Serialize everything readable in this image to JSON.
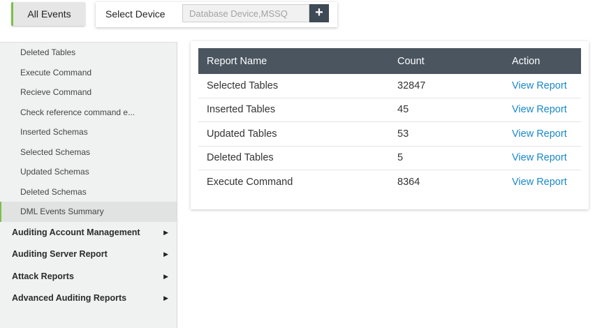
{
  "top_bar": {
    "all_events_label": "All Events",
    "select_device_label": "Select Device",
    "device_input_placeholder": "Database Device,MSSQ",
    "add_button_label": "+"
  },
  "sidebar": {
    "sub_items": [
      {
        "label": "Deleted Tables"
      },
      {
        "label": "Execute Command"
      },
      {
        "label": "Recieve Command"
      },
      {
        "label": "Check reference command e..."
      },
      {
        "label": "Inserted Schemas"
      },
      {
        "label": "Selected Schemas"
      },
      {
        "label": "Updated Schemas"
      },
      {
        "label": "Deleted Schemas"
      },
      {
        "label": "DML Events Summary",
        "active": true
      }
    ],
    "groups": [
      {
        "label": "Auditing Account Management",
        "icon": "caret-right-icon"
      },
      {
        "label": "Auditing Server Report",
        "icon": "caret-right-icon"
      },
      {
        "label": "Attack Reports",
        "icon": "caret-right-icon"
      },
      {
        "label": "Advanced Auditing Reports",
        "icon": "caret-right-icon"
      }
    ]
  },
  "report_table": {
    "headers": {
      "name": "Report Name",
      "count": "Count",
      "action": "Action"
    },
    "rows": [
      {
        "name": "Selected Tables",
        "count": "32847",
        "action": "View Report"
      },
      {
        "name": "Inserted Tables",
        "count": "45",
        "action": "View Report"
      },
      {
        "name": "Updated Tables",
        "count": "53",
        "action": "View Report"
      },
      {
        "name": "Deleted Tables",
        "count": "5",
        "action": "View Report"
      },
      {
        "name": "Execute Command",
        "count": "8364",
        "action": "View Report"
      }
    ]
  },
  "colors": {
    "accent_green": "#7cc04b",
    "header_dark": "#4a5560",
    "link_blue": "#1a88c9",
    "add_button": "#3e4a55"
  }
}
